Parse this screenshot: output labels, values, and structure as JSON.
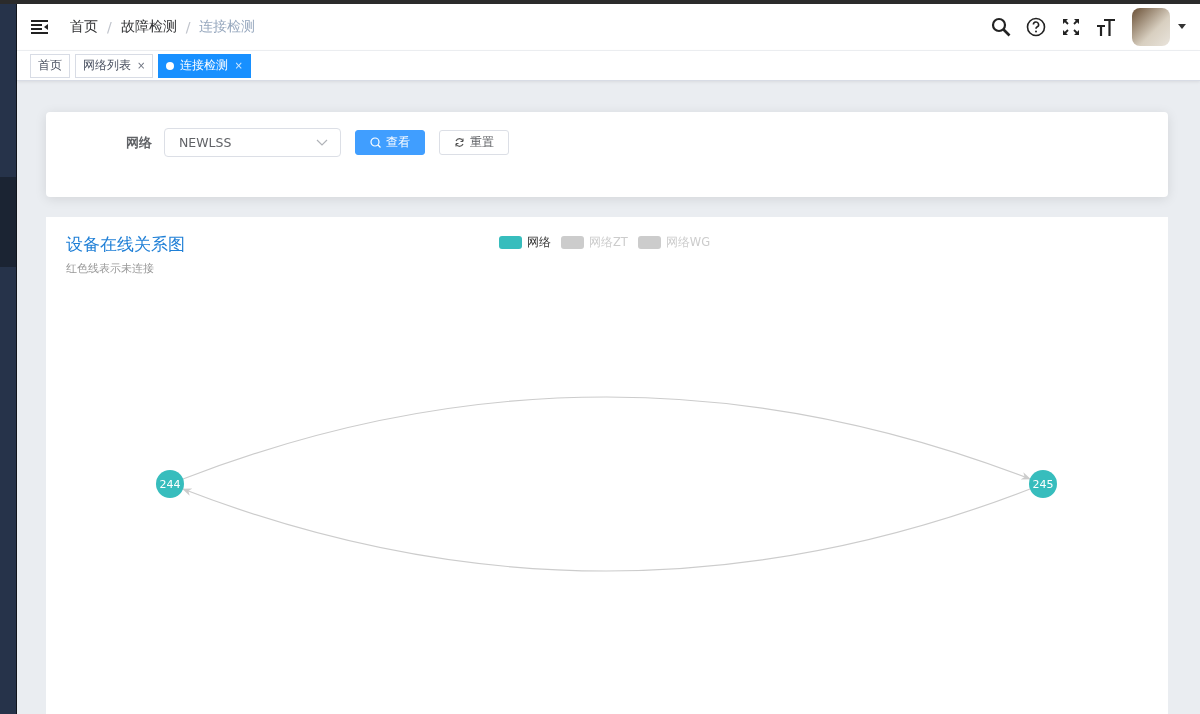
{
  "breadcrumb": [
    {
      "label": "首页",
      "current": false,
      "separator": "/"
    },
    {
      "label": "故障检测",
      "current": false,
      "separator": "/"
    },
    {
      "label": "连接检测",
      "current": true
    }
  ],
  "tabs": [
    {
      "label": "首页",
      "selected": false
    },
    {
      "label": "网络列表",
      "selected": false,
      "close": "×"
    },
    {
      "label": "连接检测",
      "selected": true,
      "close": "×"
    }
  ],
  "filter": {
    "label": "网络",
    "select_value": "NEWLSS",
    "buttons": [
      {
        "label": "查看",
        "kind": "primary"
      },
      {
        "label": "重置",
        "kind": "default"
      }
    ]
  },
  "chart": {
    "title": "设备在线关系图",
    "subtitle": "红色线表示未连接",
    "legend": [
      {
        "label": "网络",
        "selected": true,
        "color": "#37bdbd"
      },
      {
        "label": "网络ZT",
        "selected": false
      },
      {
        "label": "网络WG",
        "selected": false
      }
    ],
    "nodes": [
      {
        "label": "244",
        "color": "#37bdbd"
      },
      {
        "label": "245",
        "color": "#37bdbd"
      }
    ],
    "edges": [
      {
        "connected": true
      },
      {
        "connected": true
      }
    ]
  }
}
